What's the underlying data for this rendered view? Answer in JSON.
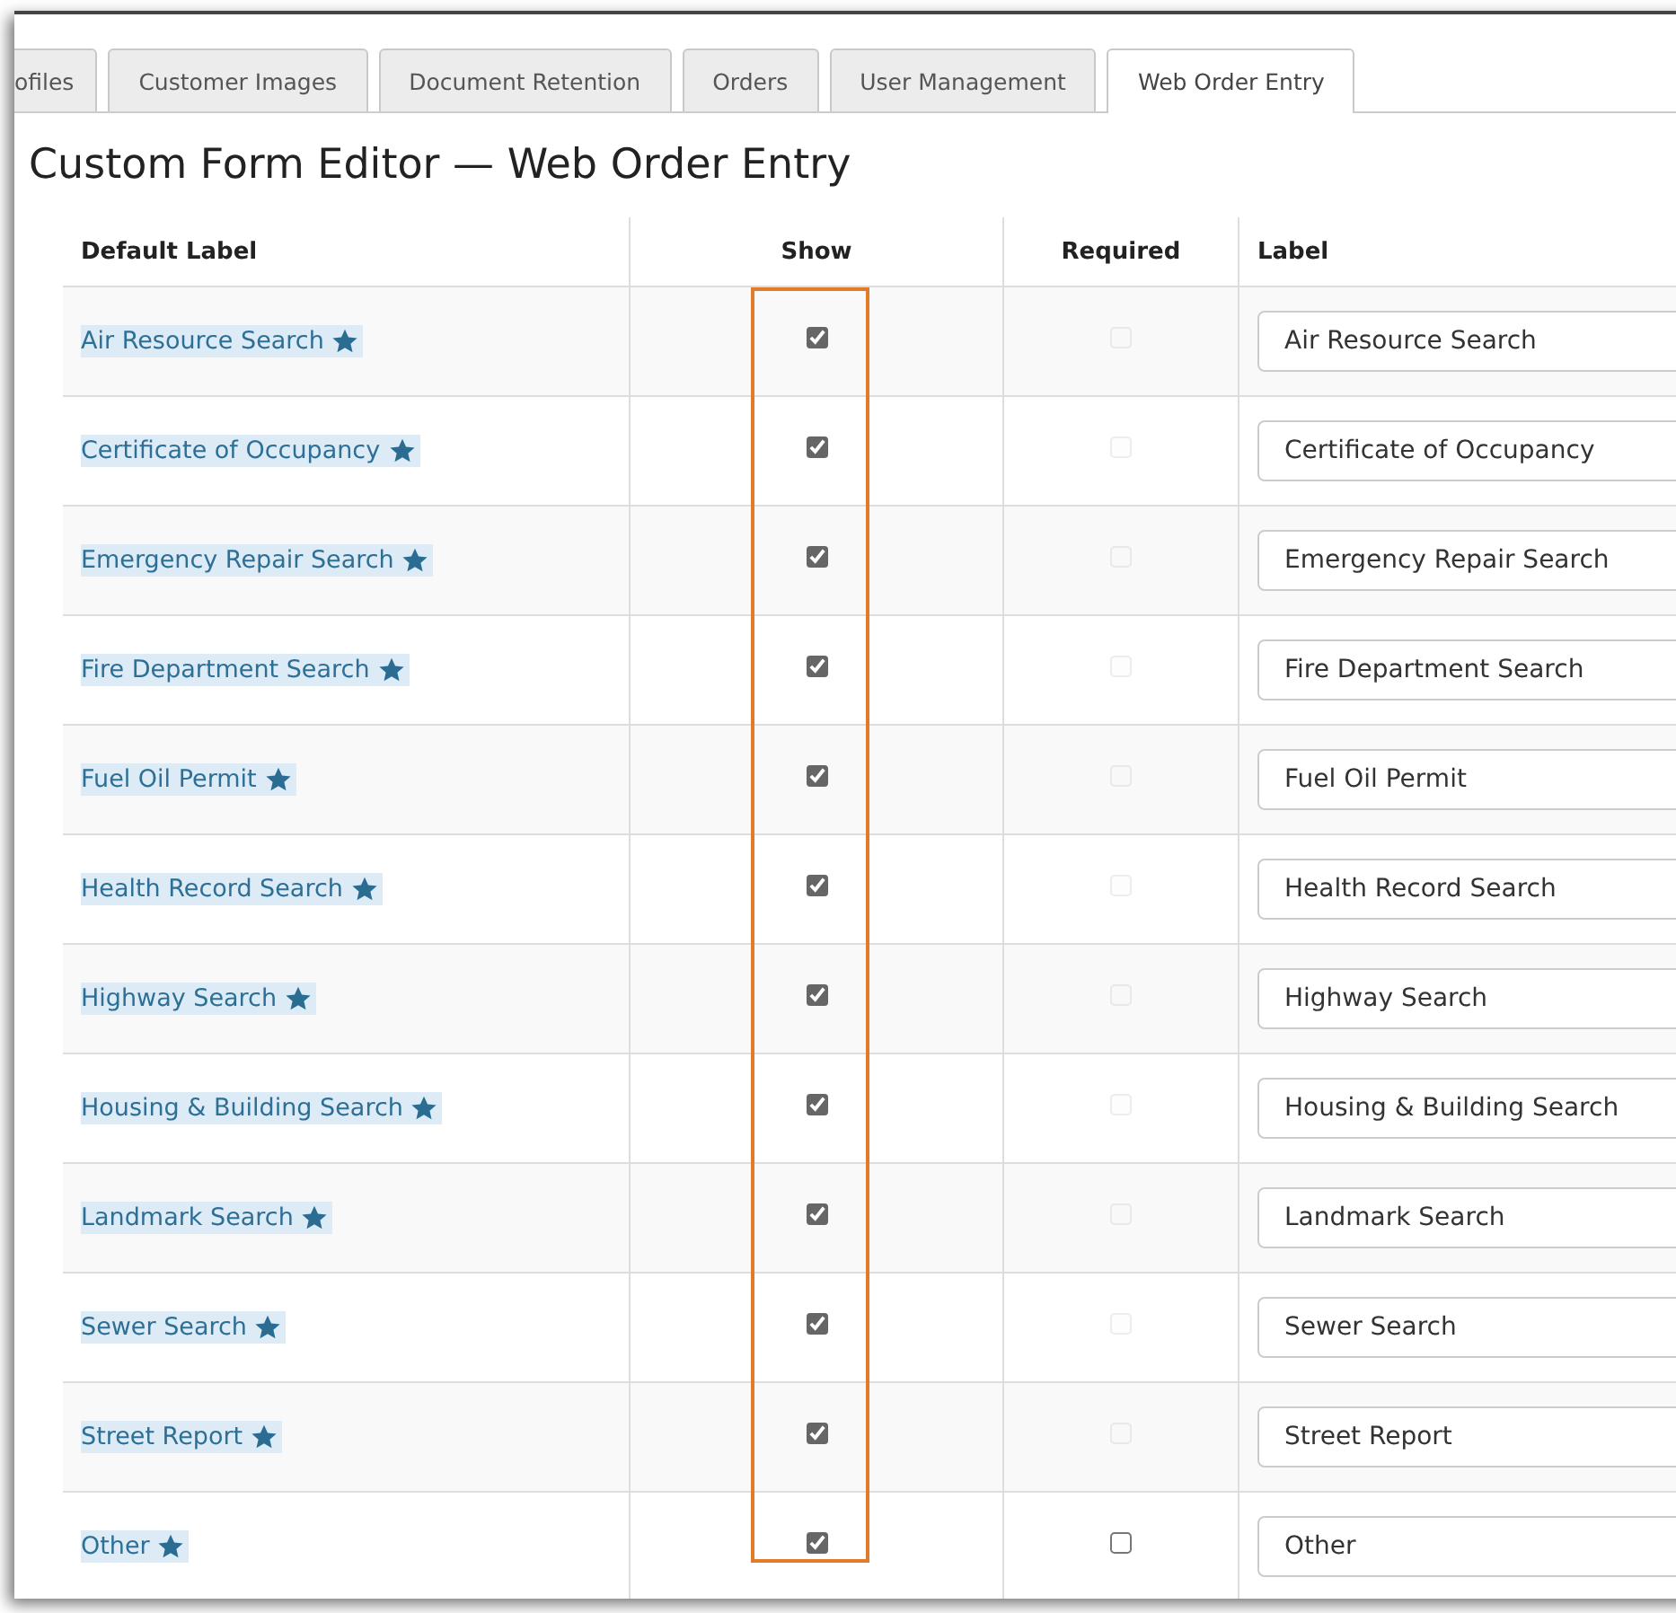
{
  "tabs": [
    {
      "label": "ofiles",
      "selected": false
    },
    {
      "label": "Customer Images",
      "selected": false
    },
    {
      "label": "Document Retention",
      "selected": false
    },
    {
      "label": "Orders",
      "selected": false
    },
    {
      "label": "User Management",
      "selected": false
    },
    {
      "label": "Web Order Entry",
      "selected": true
    }
  ],
  "title": "Custom Form Editor — Web Order Entry",
  "table": {
    "columns": [
      "Default Label",
      "Show",
      "Required",
      "Label"
    ],
    "rows": [
      {
        "default_label": "Air Resource Search",
        "show": true,
        "required": false,
        "required_disabled": true,
        "label": "Air Resource Search"
      },
      {
        "default_label": "Certificate of Occupancy",
        "show": true,
        "required": false,
        "required_disabled": true,
        "label": "Certificate of Occupancy"
      },
      {
        "default_label": "Emergency Repair Search",
        "show": true,
        "required": false,
        "required_disabled": true,
        "label": "Emergency Repair Search"
      },
      {
        "default_label": "Fire Department Search",
        "show": true,
        "required": false,
        "required_disabled": true,
        "label": "Fire Department Search"
      },
      {
        "default_label": "Fuel Oil Permit",
        "show": true,
        "required": false,
        "required_disabled": true,
        "label": "Fuel Oil Permit"
      },
      {
        "default_label": "Health Record Search",
        "show": true,
        "required": false,
        "required_disabled": true,
        "label": "Health Record Search"
      },
      {
        "default_label": "Highway Search",
        "show": true,
        "required": false,
        "required_disabled": true,
        "label": "Highway Search"
      },
      {
        "default_label": "Housing & Building Search",
        "show": true,
        "required": false,
        "required_disabled": true,
        "label": "Housing & Building Search"
      },
      {
        "default_label": "Landmark Search",
        "show": true,
        "required": false,
        "required_disabled": true,
        "label": "Landmark Search"
      },
      {
        "default_label": "Sewer Search",
        "show": true,
        "required": false,
        "required_disabled": true,
        "label": "Sewer Search"
      },
      {
        "default_label": "Street Report",
        "show": true,
        "required": false,
        "required_disabled": true,
        "label": "Street Report"
      },
      {
        "default_label": "Other",
        "show": true,
        "required": false,
        "required_disabled": false,
        "label": "Other"
      }
    ]
  }
}
